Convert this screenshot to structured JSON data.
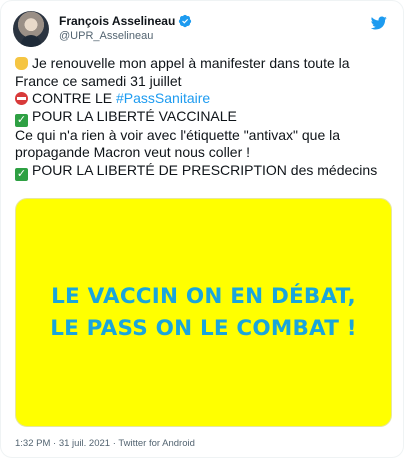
{
  "author": {
    "name": "François Asselineau",
    "handle": "@UPR_Asselineau"
  },
  "tweet": {
    "line1": "Je renouvelle mon appel à manifester dans toute la",
    "line2": "France ce samedi 31 juillet",
    "line3_prefix": "CONTRE LE ",
    "line3_hashtag": "#PassSanitaire",
    "line4": "POUR LA LIBERTÉ VACCINALE",
    "line5": "Ce qui n'a rien à voir avec l'étiquette \"antivax\" que la",
    "line6": "propagande Macron veut nous coller !",
    "line7": "POUR LA LIBERTÉ DE PRESCRIPTION des médecins"
  },
  "media": {
    "line1": "LE VACCIN ON EN DÉBAT,",
    "line2": "LE PASS ON LE COMBAT !",
    "background": "#ffff00",
    "text_color": "#19a5dc"
  },
  "meta": {
    "timestamp": "1:32 PM · 31 juil. 2021 · Twitter for Android"
  },
  "icons": {
    "verified": "verified-badge-icon",
    "follow": "twitter-bird-icon",
    "fist": "raised-fist-icon",
    "no_entry": "no-entry-icon",
    "check": "check-mark-icon"
  }
}
